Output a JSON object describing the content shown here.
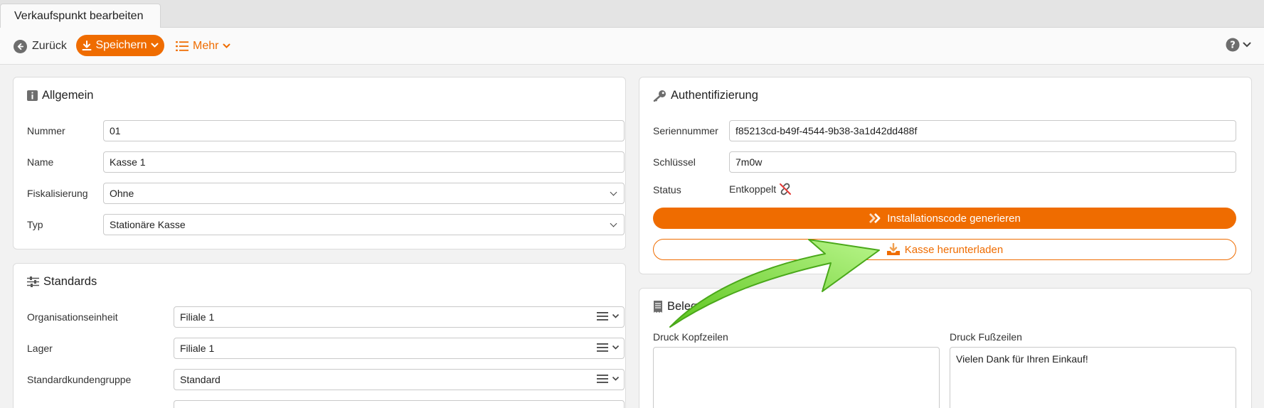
{
  "tab": {
    "title": "Verkaufspunkt bearbeiten"
  },
  "toolbar": {
    "back_label": "Zurück",
    "save_label": "Speichern",
    "more_label": "Mehr"
  },
  "allgemein": {
    "title": "Allgemein",
    "fields": [
      {
        "label": "Nummer",
        "value": "01"
      },
      {
        "label": "Name",
        "value": "Kasse 1"
      },
      {
        "label": "Fiskalisierung",
        "value": "Ohne"
      },
      {
        "label": "Typ",
        "value": "Stationäre Kasse"
      }
    ]
  },
  "standards": {
    "title": "Standards",
    "fields": [
      {
        "label": "Organisationseinheit",
        "value": "Filiale 1"
      },
      {
        "label": "Lager",
        "value": "Filiale 1"
      },
      {
        "label": "Standardkundengruppe",
        "value": "Standard"
      }
    ]
  },
  "auth": {
    "title": "Authentifizierung",
    "serial_label": "Seriennummer",
    "serial_value": "f85213cd-b49f-4544-9b38-3a1d42dd488f",
    "key_label": "Schlüssel",
    "key_value": "7m0w",
    "status_label": "Status",
    "status_value": "Entkoppelt",
    "generate_label": "Installationscode generieren",
    "download_label": "Kasse herunterladen"
  },
  "beleg": {
    "title": "Beleg",
    "header_label": "Druck Kopfzeilen",
    "header_value": "",
    "footer_label": "Druck Fußzeilen",
    "footer_value": "Vielen Dank für Ihren Einkauf!"
  },
  "colors": {
    "accent": "#ef6c00",
    "annotation_arrow": "#7ed321"
  }
}
